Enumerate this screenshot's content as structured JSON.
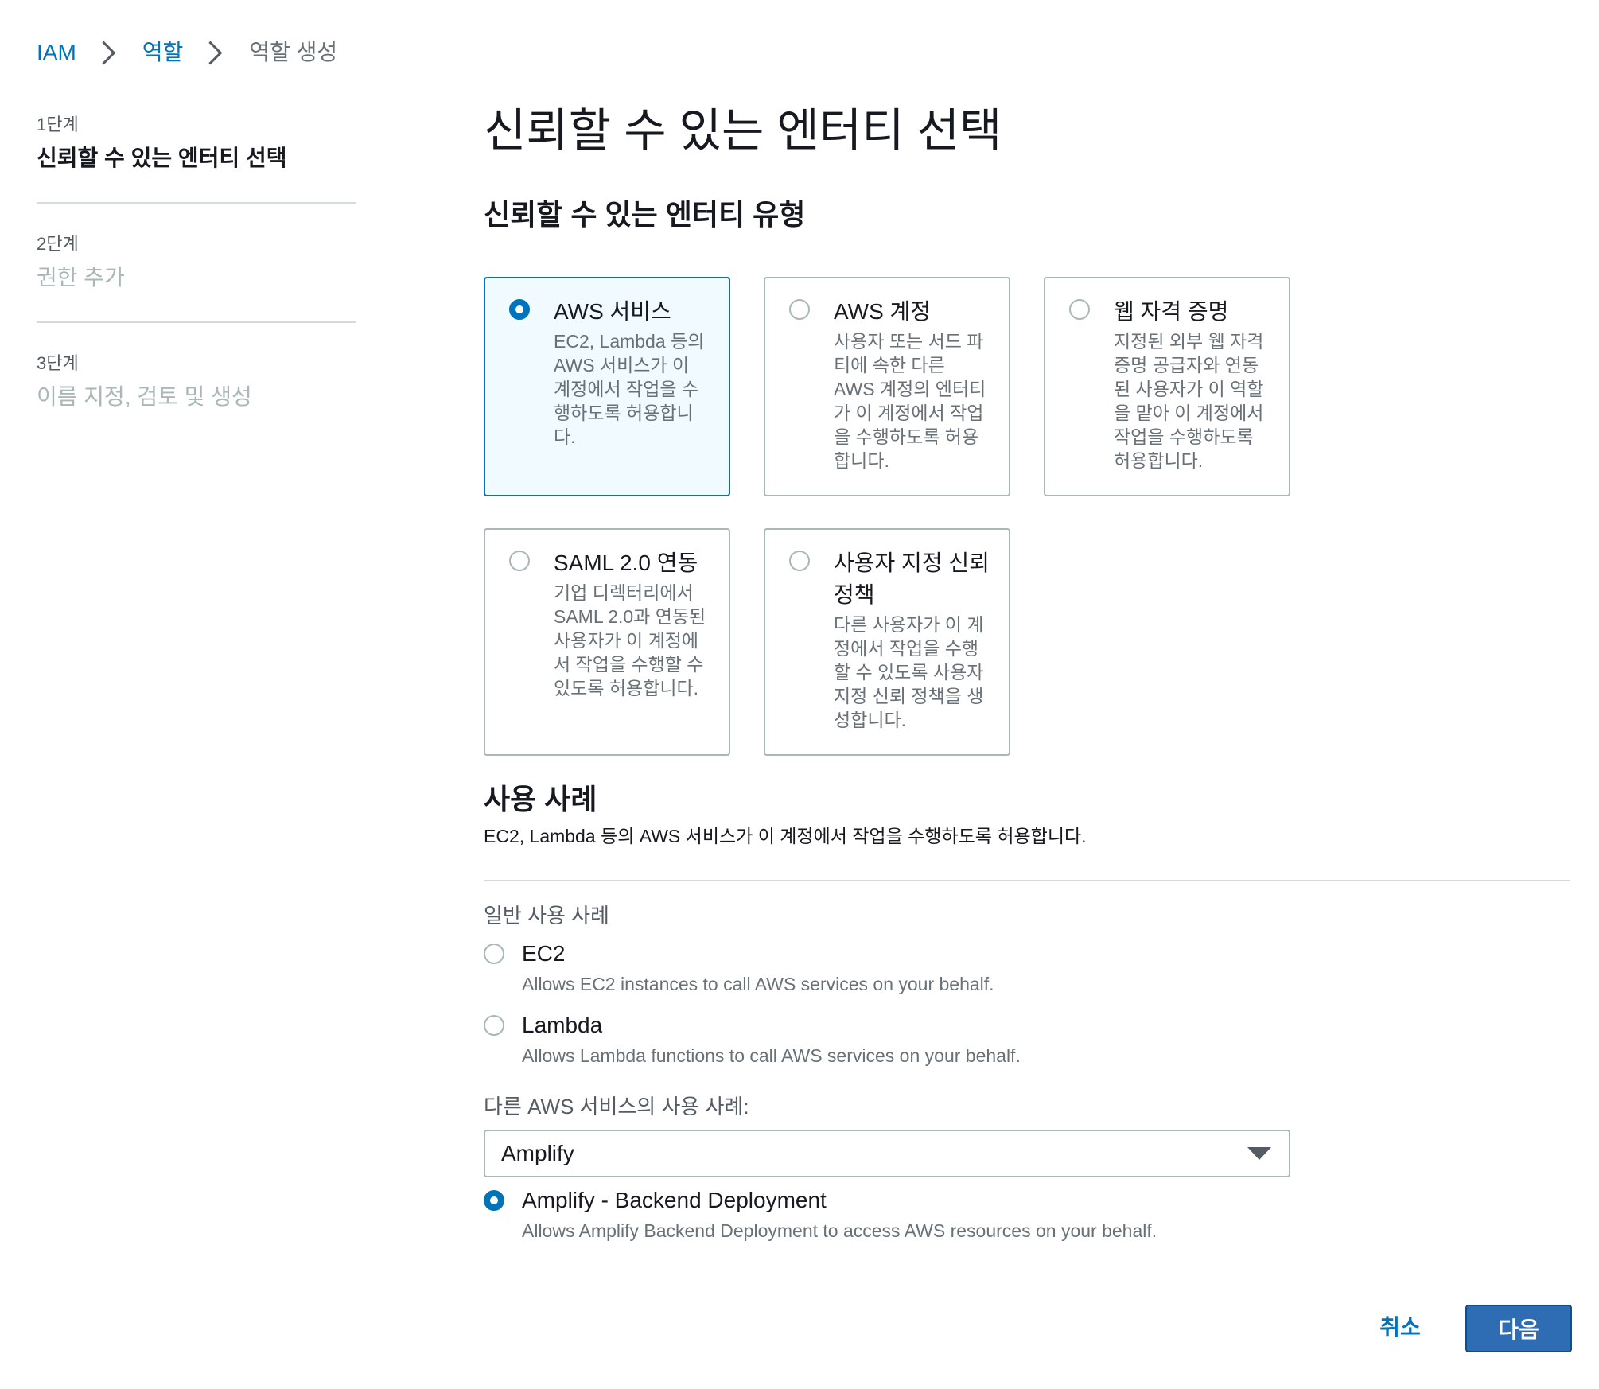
{
  "breadcrumb": {
    "items": [
      "IAM",
      "역할",
      "역할 생성"
    ]
  },
  "steps": [
    {
      "num": "1단계",
      "title": "신뢰할 수 있는 엔터티 선택"
    },
    {
      "num": "2단계",
      "title": "권한 추가"
    },
    {
      "num": "3단계",
      "title": "이름 지정, 검토 및 생성"
    }
  ],
  "page": {
    "title": "신뢰할 수 있는 엔터티 선택",
    "entity_section_title": "신뢰할 수 있는 엔터티 유형"
  },
  "entity_types": [
    {
      "title": "AWS 서비스",
      "desc": "EC2, Lambda 등의 AWS 서비스가 이 계정에서 작업을 수행하도록 허용합니다.",
      "selected": true
    },
    {
      "title": "AWS 계정",
      "desc": "사용자 또는 서드 파티에 속한 다른 AWS 계정의 엔터티가 이 계정에서 작업을 수행하도록 허용합니다.",
      "selected": false
    },
    {
      "title": "웹 자격 증명",
      "desc": "지정된 외부 웹 자격 증명 공급자와 연동된 사용자가 이 역할을 맡아 이 계정에서 작업을 수행하도록 허용합니다.",
      "selected": false
    },
    {
      "title": "SAML 2.0 연동",
      "desc": "기업 디렉터리에서 SAML 2.0과 연동된 사용자가 이 계정에서 작업을 수행할 수 있도록 허용합니다.",
      "selected": false
    },
    {
      "title": "사용자 지정 신뢰 정책",
      "desc": "다른 사용자가 이 계정에서 작업을 수행할 수 있도록 사용자 지정 신뢰 정책을 생성합니다.",
      "selected": false
    }
  ],
  "use_case": {
    "title": "사용 사례",
    "desc": "EC2, Lambda 등의 AWS 서비스가 이 계정에서 작업을 수행하도록 허용합니다.",
    "common_label": "일반 사용 사례",
    "common_options": [
      {
        "title": "EC2",
        "desc": "Allows EC2 instances to call AWS services on your behalf.",
        "selected": false
      },
      {
        "title": "Lambda",
        "desc": "Allows Lambda functions to call AWS services on your behalf.",
        "selected": false
      }
    ],
    "other_label": "다른 AWS 서비스의 사용 사례:",
    "service_select_value": "Amplify",
    "service_options": [
      {
        "title": "Amplify - Backend Deployment",
        "desc": "Allows Amplify Backend Deployment to access AWS resources on your behalf.",
        "selected": true
      }
    ]
  },
  "footer": {
    "cancel_label": "취소",
    "next_label": "다음"
  },
  "colors": {
    "accent": "#0073bb",
    "primary_button": "#2e6db3",
    "selected_tile_bg": "#f1faff"
  }
}
